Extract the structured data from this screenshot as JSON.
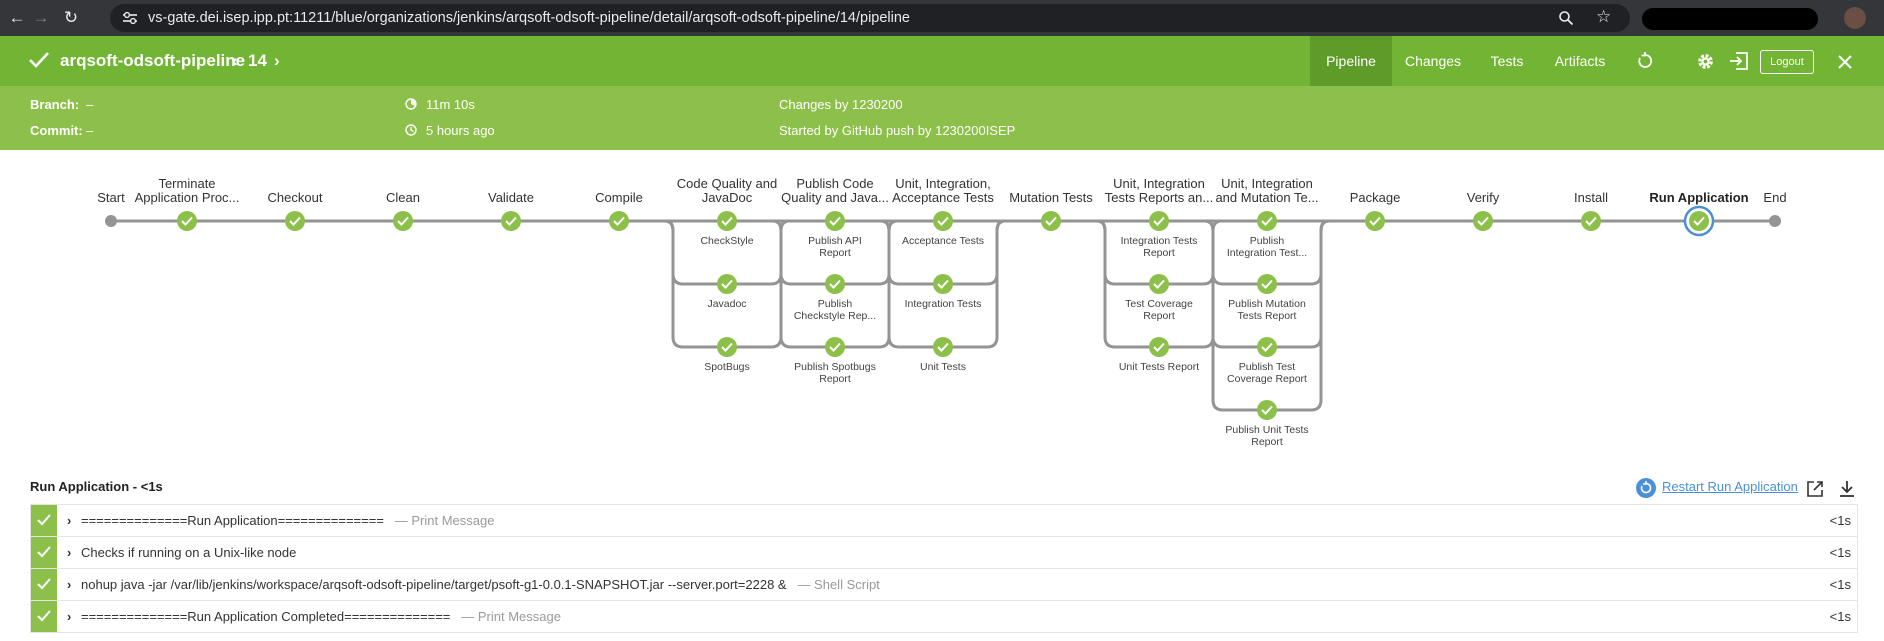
{
  "browser": {
    "url": "vs-gate.dei.isep.ipp.pt:11211/blue/organizations/jenkins/arqsoft-odsoft-pipeline/detail/arqsoft-odsoft-pipeline/14/pipeline"
  },
  "header": {
    "pipeline_name": "arqsoft-odsoft-pipeline",
    "prev_symbol": "‹",
    "run_number": "14",
    "next_symbol": "›",
    "tabs": [
      {
        "label": "Pipeline",
        "active": true
      },
      {
        "label": "Changes",
        "active": false
      },
      {
        "label": "Tests",
        "active": false
      },
      {
        "label": "Artifacts",
        "active": false
      }
    ],
    "logout_label": "Logout"
  },
  "info": {
    "branch_label": "Branch:",
    "branch_value": "–",
    "commit_label": "Commit:",
    "commit_value": "–",
    "duration": "11m 10s",
    "ago": "5 hours ago",
    "changes": "Changes by 1230200",
    "started": "Started by GitHub push by 1230200ISEP"
  },
  "pipeline": {
    "start_label": "Start",
    "end_label": "End",
    "stages": [
      {
        "title": [
          "Terminate",
          "Application Proc..."
        ],
        "selected": false,
        "branches": []
      },
      {
        "title": [
          "Checkout"
        ],
        "selected": false,
        "branches": []
      },
      {
        "title": [
          "Clean"
        ],
        "selected": false,
        "branches": []
      },
      {
        "title": [
          "Validate"
        ],
        "selected": false,
        "branches": []
      },
      {
        "title": [
          "Compile"
        ],
        "selected": false,
        "branches": []
      },
      {
        "title": [
          "Code Quality and",
          "JavaDoc"
        ],
        "selected": false,
        "branches": [
          [
            "CheckStyle"
          ],
          [
            "Javadoc"
          ],
          [
            "SpotBugs"
          ]
        ]
      },
      {
        "title": [
          "Publish Code",
          "Quality and Java..."
        ],
        "selected": false,
        "branches": [
          [
            "Publish API",
            "Report"
          ],
          [
            "Publish",
            "Checkstyle Rep..."
          ],
          [
            "Publish Spotbugs",
            "Report"
          ]
        ]
      },
      {
        "title": [
          "Unit, Integration,",
          "Acceptance Tests"
        ],
        "selected": false,
        "branches": [
          [
            "Acceptance Tests"
          ],
          [
            "Integration Tests"
          ],
          [
            "Unit Tests"
          ]
        ]
      },
      {
        "title": [
          "Mutation Tests"
        ],
        "selected": false,
        "branches": []
      },
      {
        "title": [
          "Unit, Integration",
          "Tests Reports an..."
        ],
        "selected": false,
        "branches": [
          [
            "Integration Tests",
            "Report"
          ],
          [
            "Test Coverage",
            "Report"
          ],
          [
            "Unit Tests Report"
          ]
        ]
      },
      {
        "title": [
          "Unit, Integration",
          "and Mutation Te..."
        ],
        "selected": false,
        "branches": [
          [
            "Publish",
            "Integration Test..."
          ],
          [
            "Publish Mutation",
            "Tests Report"
          ],
          [
            "Publish Test",
            "Coverage Report"
          ],
          [
            "Publish Unit Tests",
            "Report"
          ]
        ]
      },
      {
        "title": [
          "Package"
        ],
        "selected": false,
        "branches": []
      },
      {
        "title": [
          "Verify"
        ],
        "selected": false,
        "branches": []
      },
      {
        "title": [
          "Install"
        ],
        "selected": false,
        "branches": []
      },
      {
        "title": [
          "Run Application"
        ],
        "selected": true,
        "branches": []
      }
    ]
  },
  "log": {
    "title": "Run Application - <1s",
    "restart_label": "Restart Run Application",
    "steps": [
      {
        "text": "==============Run Application==============",
        "kind": "— Print Message",
        "duration": "<1s"
      },
      {
        "text": "Checks if running on a Unix-like node",
        "kind": "",
        "duration": "<1s"
      },
      {
        "text": "nohup java -jar /var/lib/jenkins/workspace/arqsoft-odsoft-pipeline/target/psoft-g1-0.0.1-SNAPSHOT.jar --server.port=2228 &",
        "kind": "— Shell Script",
        "duration": "<1s"
      },
      {
        "text": "==============Run Application Completed==============",
        "kind": "— Print Message",
        "duration": "<1s"
      }
    ]
  },
  "colors": {
    "header_green": "#72b433",
    "info_green": "#8cc04a",
    "success_node": "#8cc04a",
    "selected_ring": "#4a90d9",
    "link_blue": "#4a90d9"
  }
}
